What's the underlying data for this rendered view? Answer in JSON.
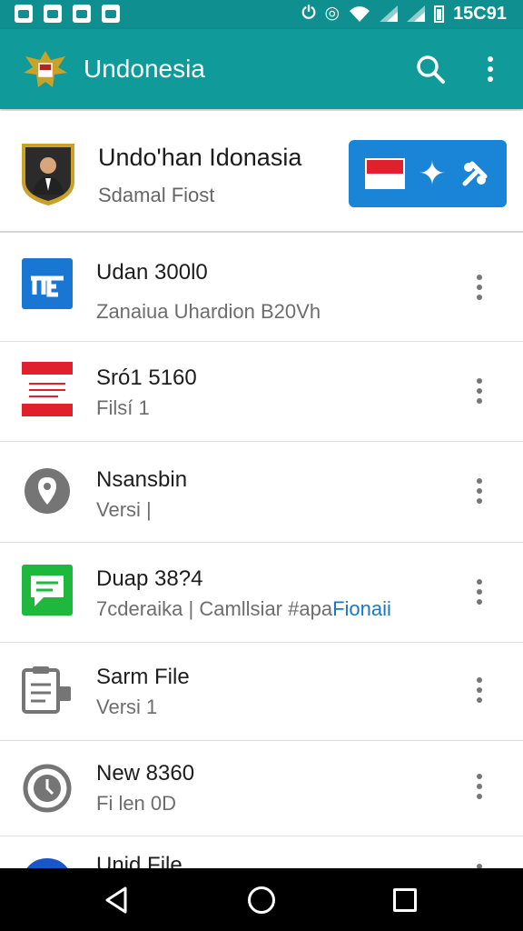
{
  "status_bar": {
    "time": "15C91"
  },
  "app_bar": {
    "title": "Undonesia"
  },
  "header": {
    "title": "Undo'han Idonasia",
    "subtitle": "Sdamal Fiost"
  },
  "files": [
    {
      "title": "Udan 300l0",
      "subtitle": "Zanaiua Uhardion B20Vh",
      "icon": "blue-doc-icon"
    },
    {
      "title": "Sró1 5160",
      "subtitle": "Fi⁠lsí 1",
      "icon": "red-window-icon"
    },
    {
      "title": "Nsansbin",
      "subtitle": "Versi |",
      "icon": "location-pin-icon"
    },
    {
      "title": "Duap 38?4",
      "subtitle_prefix": "7cderaika | Camllsiar #apa",
      "subtitle_link": "Fionaii",
      "icon": "green-message-icon"
    },
    {
      "title": "Sarm File",
      "subtitle": "Versi 1",
      "icon": "clipboard-icon"
    },
    {
      "title": "New 8360",
      "subtitle": "Fi len 0D",
      "icon": "clock-icon"
    },
    {
      "title": "Unid File",
      "icon": "blue-round-icon"
    }
  ],
  "colors": {
    "app_bar": "#119a9a",
    "status_bar": "#0f8f8f",
    "action_box": "#1a84d6",
    "link": "#1a78c2"
  }
}
